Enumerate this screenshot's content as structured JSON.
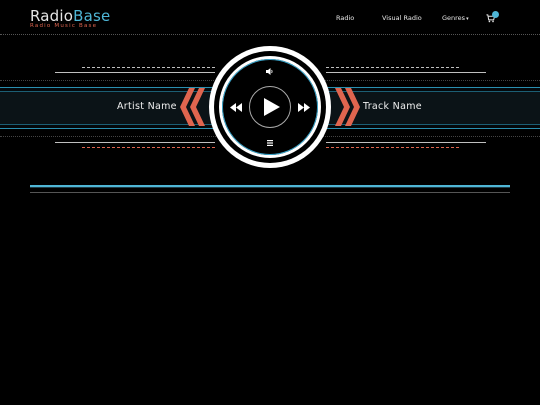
{
  "brand": {
    "name_main": "Radio",
    "name_accent": "Base",
    "tagline": "Radio Music Base",
    "accent_color": "#4fb6d6",
    "tagline_color": "#e0654f"
  },
  "nav": {
    "items": [
      {
        "label": "Radio"
      },
      {
        "label": "Visual Radio"
      },
      {
        "label": "Genres"
      }
    ],
    "cart_icon": "shopping-cart-icon",
    "cart_count": ""
  },
  "player": {
    "artist": "Artist Name",
    "track": "Track Name",
    "icons": [
      "volume-icon",
      "rewind-icon",
      "play-icon",
      "fast-forward-icon",
      "menu-icon"
    ],
    "chevron_color": "#e0654f",
    "band_color": "#2a8fb0"
  }
}
